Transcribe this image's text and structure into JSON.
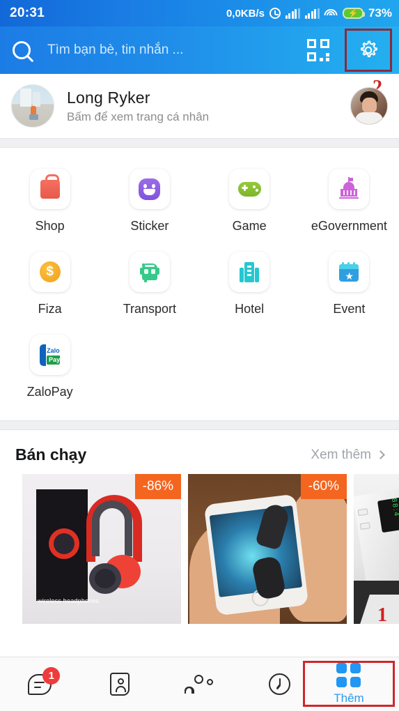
{
  "status_bar": {
    "time": "20:31",
    "network_speed": "0,0KB/s",
    "battery_percent": "73%",
    "icons": [
      "alarm-icon",
      "signal-bars-sim1-icon",
      "signal-bars-sim2-icon",
      "wifi-icon",
      "battery-charging-icon"
    ]
  },
  "search_bar": {
    "placeholder": "Tìm bạn bè, tin nhắn ...",
    "value": "",
    "search_icon": "search-icon",
    "qr_icon": "qr-code-icon",
    "settings_icon": "gear-icon",
    "highlight_color": "#8a2b3c"
  },
  "profile": {
    "name": "Long Ryker",
    "subtitle": "Bấm để xem trang cá nhân",
    "avatar": "user-avatar-beach",
    "right_avatar": "user-avatar-portrait",
    "annotation": "2",
    "annotation_color": "#cf2020"
  },
  "app_grid": {
    "rows": [
      [
        {
          "label": "Shop",
          "icon": "shopping-bag-icon",
          "color": "#ef6a58"
        },
        {
          "label": "Sticker",
          "icon": "smiley-sticker-icon",
          "color": "#8b5fe3"
        },
        {
          "label": "Game",
          "icon": "gamepad-icon",
          "color": "#8bc22f"
        },
        {
          "label": "eGovernment",
          "icon": "government-building-icon",
          "color": "#cc63d8"
        }
      ],
      [
        {
          "label": "Fiza",
          "icon": "dollar-coin-icon",
          "color": "#f5af1f"
        },
        {
          "label": "Transport",
          "icon": "bus-icon",
          "color": "#36c98c"
        },
        {
          "label": "Hotel",
          "icon": "hotel-building-icon",
          "color": "#25c7d1"
        },
        {
          "label": "Event",
          "icon": "calendar-star-icon",
          "color": "#2f9fe0"
        }
      ],
      [
        {
          "label": "ZaloPay",
          "icon": "zalopay-icon",
          "color": "#1063bd",
          "zalo_text": "Zalo",
          "pay_text": "Pay"
        }
      ]
    ]
  },
  "best_sellers": {
    "title": "Bán chạy",
    "more_label": "Xem thêm",
    "more_icon": "chevron-right-icon",
    "cards": [
      {
        "product": "wireless-headphones",
        "discount": "-86%",
        "caption": "wireless headphones"
      },
      {
        "product": "gaming-finger-sleeves",
        "discount": "-60%",
        "caption": ""
      },
      {
        "product": "power-bank",
        "discount": "",
        "caption": ""
      }
    ],
    "discount_badge_color": "#f4651f"
  },
  "bottom_nav": {
    "items": [
      {
        "label": "",
        "icon": "chat-bubble-icon",
        "badge": "1",
        "active": false
      },
      {
        "label": "",
        "icon": "contacts-card-icon",
        "badge": "",
        "active": false
      },
      {
        "label": "",
        "icon": "people-group-icon",
        "badge": "",
        "active": false
      },
      {
        "label": "",
        "icon": "clock-history-icon",
        "badge": "",
        "active": false
      },
      {
        "label": "Thêm",
        "icon": "grid-more-icon",
        "badge": "",
        "active": true
      }
    ],
    "active_color": "#2b9bec",
    "badge_color": "#ef3b3b",
    "highlight_color": "#d0262a",
    "annotation": "1",
    "annotation_color": "#cf2020"
  }
}
